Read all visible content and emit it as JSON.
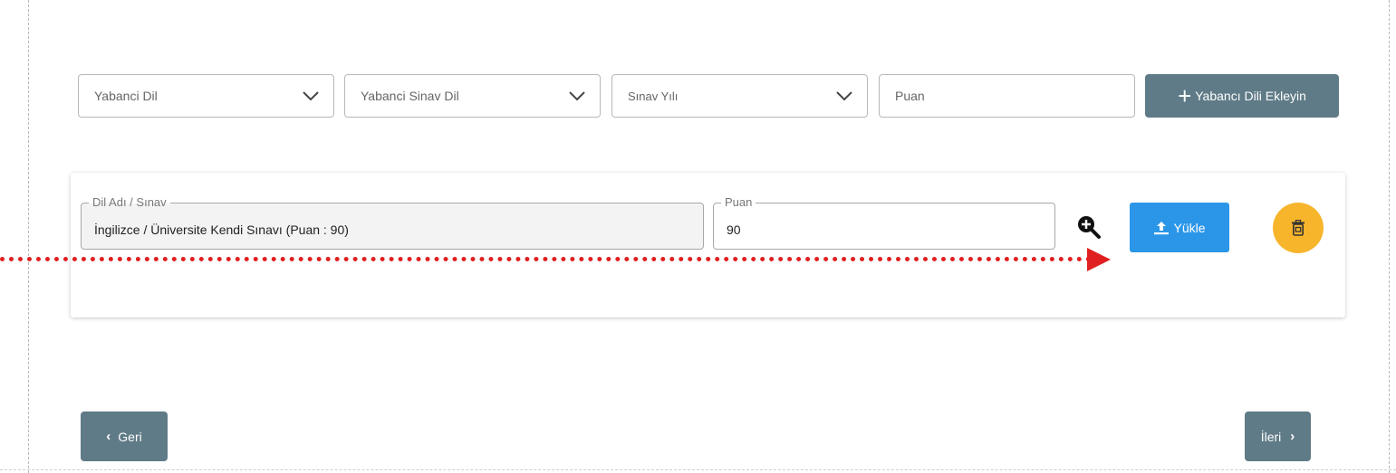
{
  "form": {
    "language_select": {
      "placeholder": "Yabanci Dil"
    },
    "exam_select": {
      "placeholder": "Yabanci Sinav Dil"
    },
    "year_select": {
      "placeholder": "Sınav Yılı"
    },
    "score_input": {
      "placeholder": "Puan"
    },
    "add_button_label": "Yabancı Dili Ekleyin"
  },
  "entry": {
    "name_legend": "Dil Adı / Sınav",
    "name_value": "İngilizce / Üniversite Kendi Sınavı (Puan : 90)",
    "score_legend": "Puan",
    "score_value": "90",
    "upload_label": "Yükle"
  },
  "navigation": {
    "back_label": "Geri",
    "next_label": "İleri"
  },
  "icons": {
    "add": "plus-icon",
    "dropdown": "chevron-down-icon",
    "zoom": "zoom-in-icon",
    "upload": "upload-icon",
    "delete": "trash-icon",
    "back": "chevron-left-icon",
    "next": "chevron-right-icon"
  },
  "colors": {
    "primary_button": "#5f7b87",
    "upload_button": "#2b96e8",
    "delete_button": "#f7b52c",
    "annotation_arrow": "#e02020"
  }
}
